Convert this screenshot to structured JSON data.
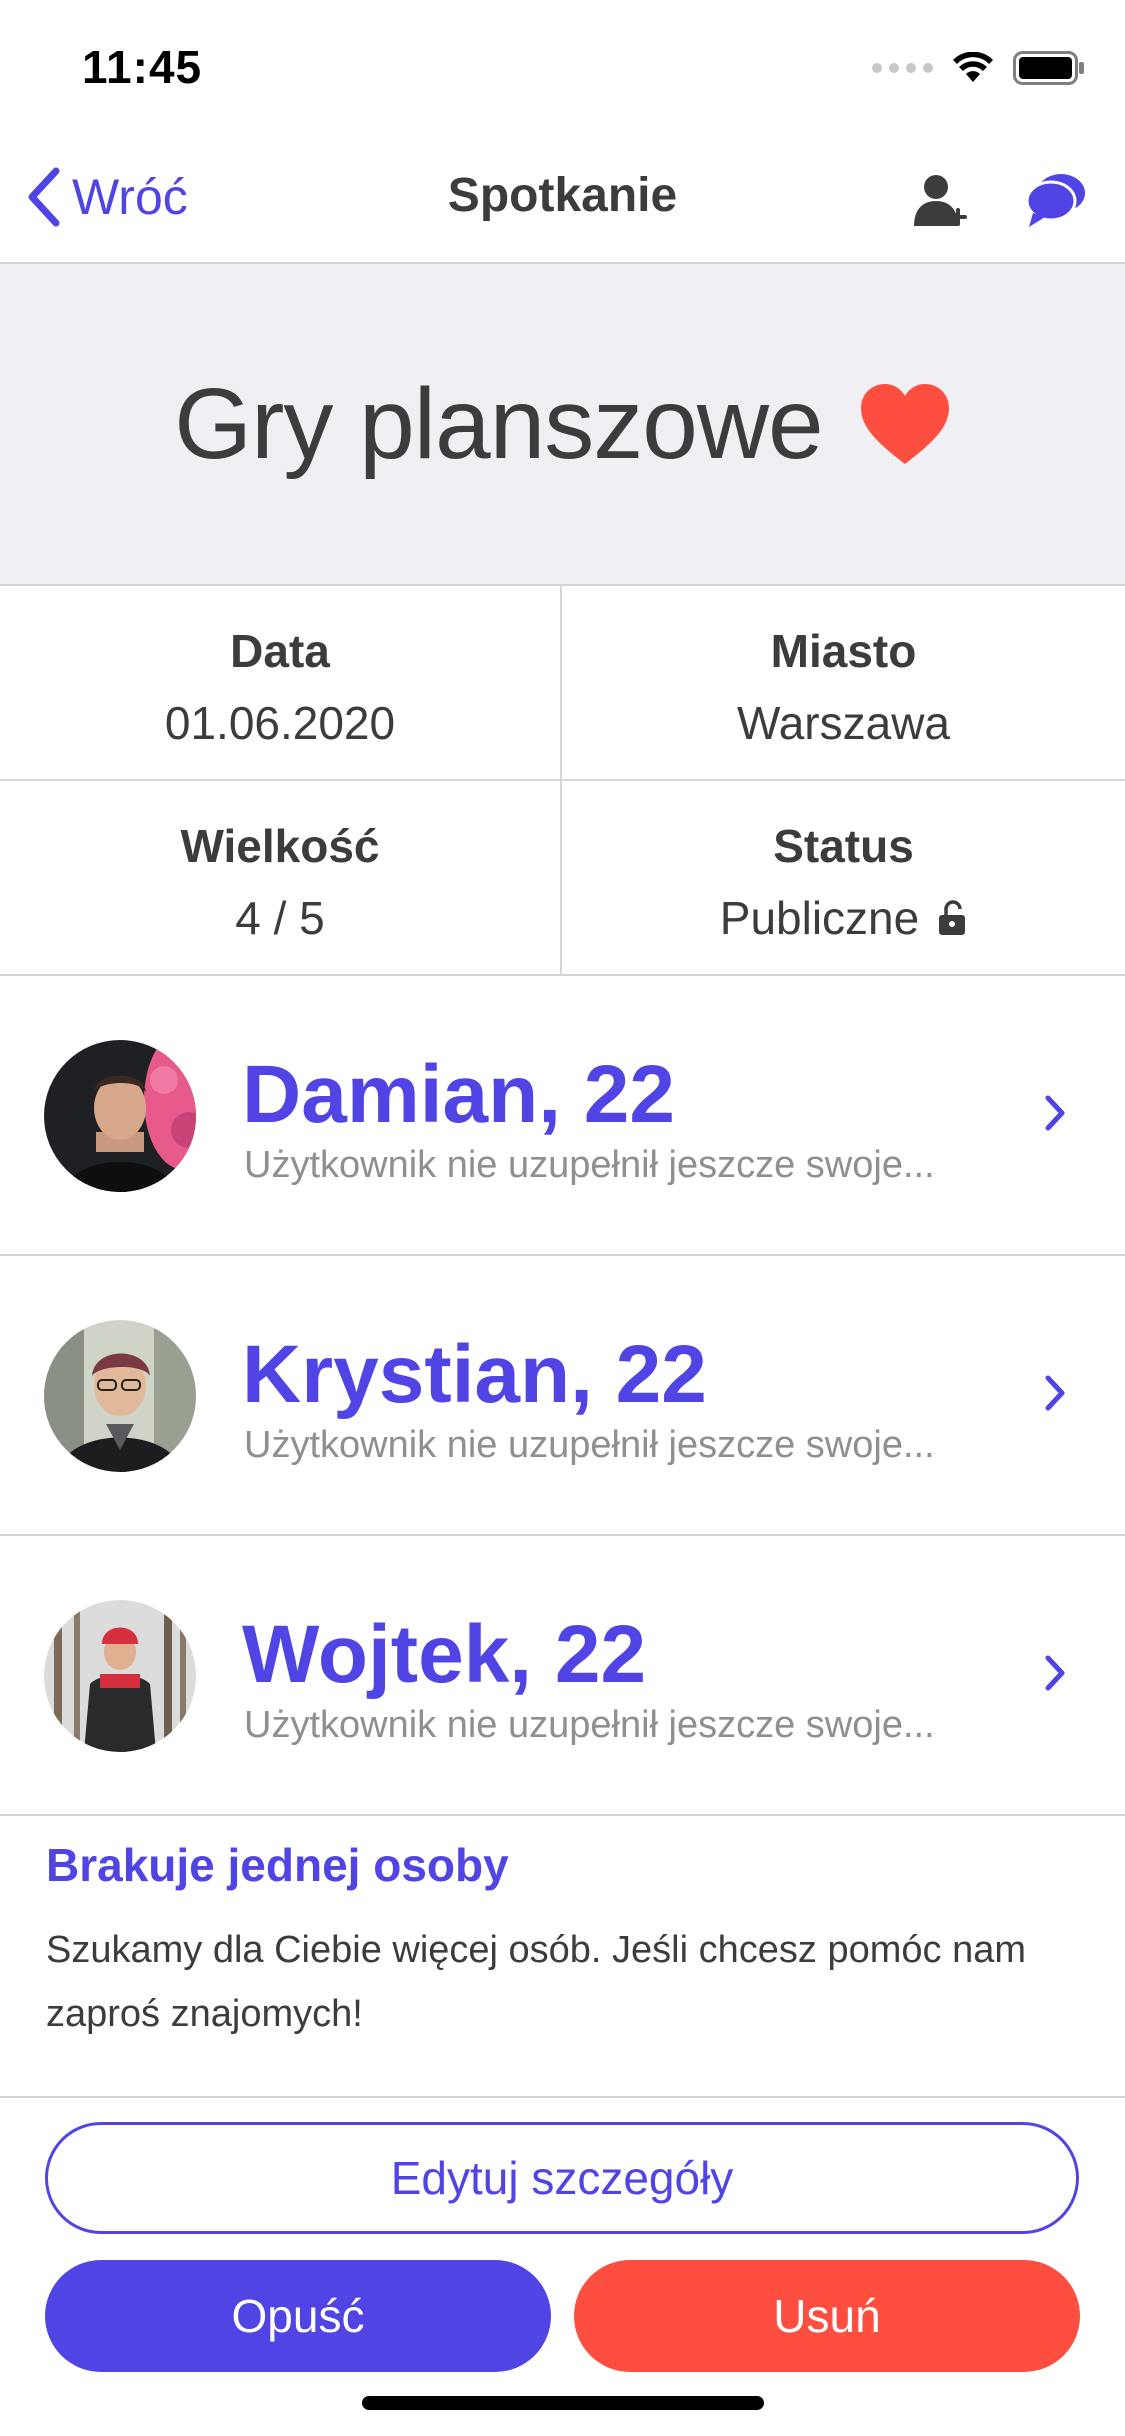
{
  "status_bar": {
    "time": "11:45"
  },
  "nav": {
    "back_label": "Wróć",
    "title": "Spotkanie",
    "icons": [
      "add-user-icon",
      "chat-icon"
    ]
  },
  "hero": {
    "title": "Gry planszowe",
    "icon": "heart-icon",
    "icon_color": "#fe4e3f"
  },
  "info": {
    "date_label": "Data",
    "date_value": "01.06.2020",
    "city_label": "Miasto",
    "city_value": "Warszawa",
    "size_label": "Wielkość",
    "size_value": "4 / 5",
    "status_label": "Status",
    "status_value": "Publiczne",
    "status_icon": "unlock-icon"
  },
  "members": [
    {
      "name": "Damian, 22",
      "description": "Użytkownik nie uzupełnił jeszcze swoje..."
    },
    {
      "name": "Krystian, 22",
      "description": "Użytkownik nie uzupełnił jeszcze swoje..."
    },
    {
      "name": "Wojtek, 22",
      "description": "Użytkownik nie uzupełnił jeszcze swoje..."
    }
  ],
  "notice": {
    "title": "Brakuje jednej osoby",
    "text": "Szukamy dla Ciebie więcej osób. Jeśli chcesz pomóc nam zaproś znajomych!"
  },
  "buttons": {
    "edit": "Edytuj szczegóły",
    "leave": "Opuść",
    "delete": "Usuń"
  },
  "colors": {
    "accent": "#5044e4",
    "danger": "#fe4e3f",
    "separator": "#d6d6d8",
    "hero_bg": "#efeff4"
  }
}
